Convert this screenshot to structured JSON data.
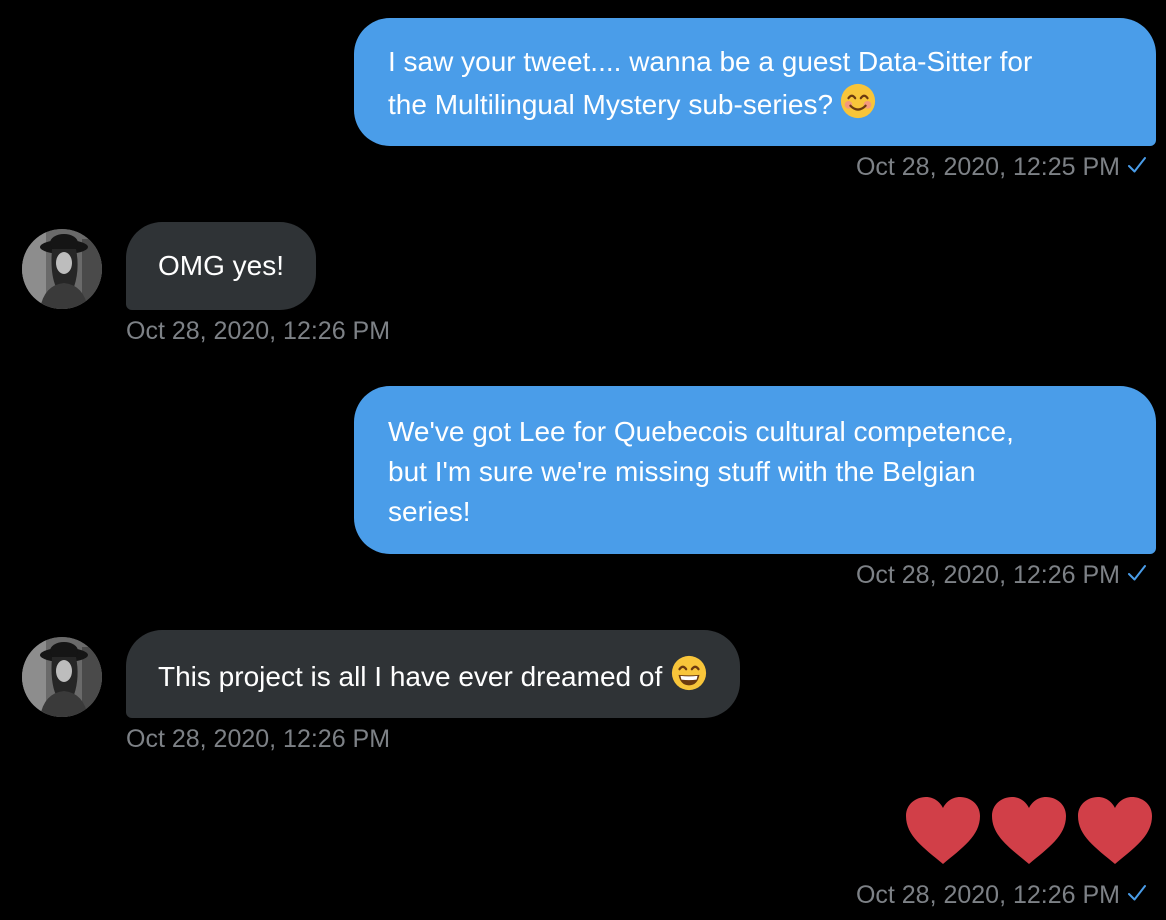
{
  "conversation": {
    "messages": [
      {
        "direction": "outgoing",
        "lines": [
          "I saw your tweet.... wanna be a guest Data-Sitter for",
          "the Multilingual Mystery sub-series?"
        ],
        "emoji": "smiling-face-with-smiling-eyes",
        "timestamp": "Oct 28, 2020, 12:25 PM",
        "read": true
      },
      {
        "direction": "incoming",
        "lines": [
          "OMG yes!"
        ],
        "timestamp": "Oct 28, 2020, 12:26 PM"
      },
      {
        "direction": "outgoing",
        "lines": [
          "We've got Lee for Quebecois cultural competence,",
          "but I'm sure we're missing stuff with the Belgian",
          "series!"
        ],
        "timestamp": "Oct 28, 2020, 12:26 PM",
        "read": true
      },
      {
        "direction": "incoming",
        "lines": [
          "This project is all I have ever dreamed of"
        ],
        "emoji": "grinning-face-with-smiling-eyes",
        "timestamp": "Oct 28, 2020, 12:26 PM"
      },
      {
        "direction": "outgoing",
        "emoji_only": [
          "red-heart",
          "red-heart",
          "red-heart"
        ],
        "timestamp": "Oct 28, 2020, 12:26 PM",
        "read": true
      }
    ]
  },
  "colors": {
    "background": "#000000",
    "outgoing_bubble": "#4a9de9",
    "incoming_bubble": "#2f3336",
    "timestamp": "#7d8186",
    "read_check": "#4a9de9",
    "heart": "#d13f48"
  }
}
